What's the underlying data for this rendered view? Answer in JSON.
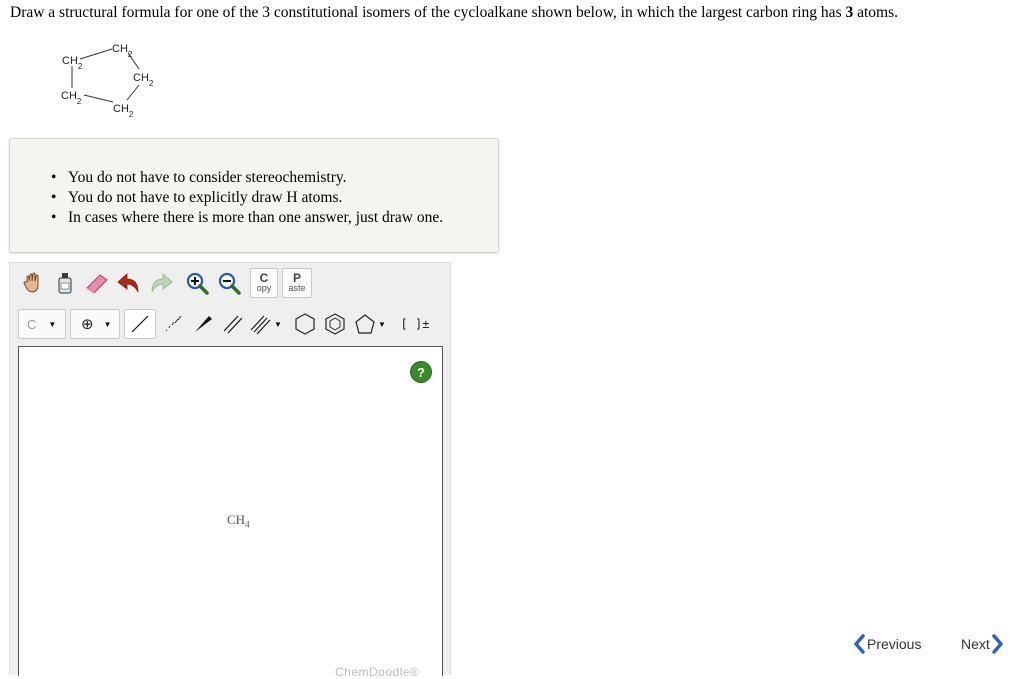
{
  "question": {
    "before": "Draw a structural formula for one of the 3 constitutional isomers of the cycloalkane shown below, in which the largest carbon ring has ",
    "bold": "3",
    "after": " atoms."
  },
  "molecule_labels": [
    "CH2",
    "CH2",
    "CH2",
    "CH2",
    "CH2"
  ],
  "hints": [
    "You do not have to consider stereochemistry.",
    "You do not have to explicitly draw H atoms.",
    "In cases where there is more than one answer, just draw one."
  ],
  "toolbar": {
    "row1_icons": [
      "hand-icon",
      "clear-bottle-icon",
      "eraser-icon",
      "undo-icon",
      "redo-icon",
      "zoom-in-icon",
      "zoom-out-icon"
    ],
    "copy": {
      "big": "C",
      "small": "opy"
    },
    "paste": {
      "big": "P",
      "small": "aste"
    },
    "element_selected": "C",
    "charge_symbol": "⊕",
    "bracket_label": "[ ]±"
  },
  "canvas": {
    "help_label": "?",
    "atom_base": "CH",
    "atom_sub": "4",
    "watermark": "ChemDoodle®"
  },
  "nav": {
    "previous": "Previous",
    "next": "Next"
  },
  "colors": {
    "help_green": "#3a8a2a",
    "nav_arrow_blue": "#2b63c5",
    "undo_red": "#b32616",
    "eraser_pink": "#e98ab0",
    "zoom_blue": "#2a56b7"
  }
}
